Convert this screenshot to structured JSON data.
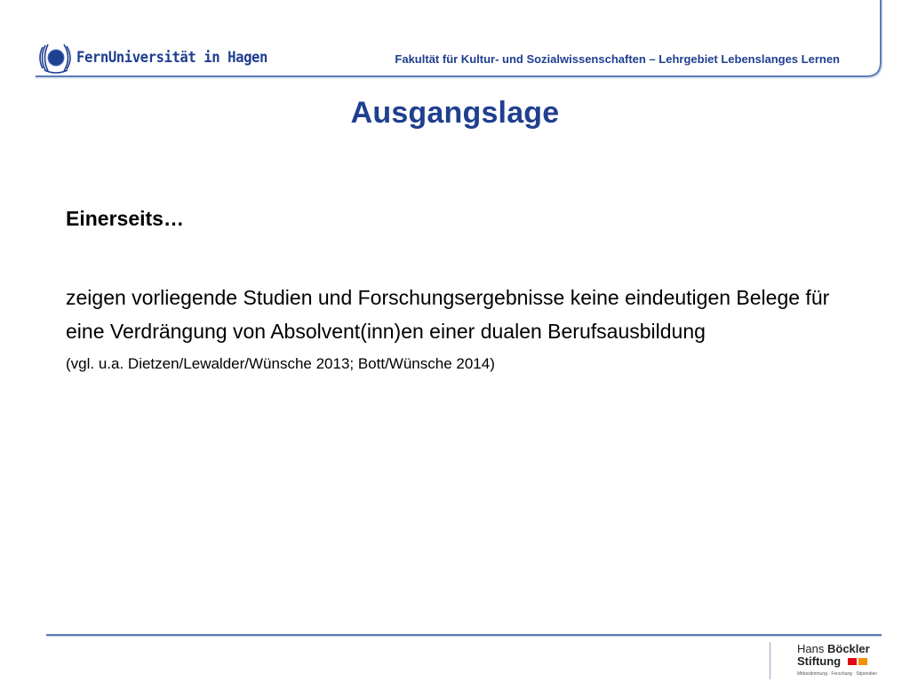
{
  "header": {
    "logo_text": "FernUniversität in Hagen",
    "faculty": "Fakultät für Kultur- und Sozialwissenschaften – Lehrgebiet Lebenslanges Lernen"
  },
  "slide": {
    "title": "Ausgangslage",
    "subhead": "Einerseits…",
    "body": "zeigen vorliegende Studien und Forschungsergebnisse keine eindeutigen Belege für eine Verdrängung von Absolvent(inn)en einer dualen Berufsausbildung",
    "citation": "(vgl. u.a. Dietzen/Lewalder/Wünsche 2013; Bott/Wünsche 2014)"
  },
  "footer": {
    "sponsor_line1_regular": "Hans",
    "sponsor_line1_bold": "Böckler",
    "sponsor_line2": "Stiftung",
    "sponsor_tagline": "Mitbestimmung · Forschung · Stipendien"
  },
  "colors": {
    "brand_blue": "#1f3f8f",
    "rule_blue": "#5b7bb3",
    "sponsor_red": "#e30613",
    "sponsor_orange": "#f39200"
  },
  "icons": {
    "logo": "fernuni-globe-icon",
    "sponsor": "hans-boeckler-mark-icon"
  }
}
